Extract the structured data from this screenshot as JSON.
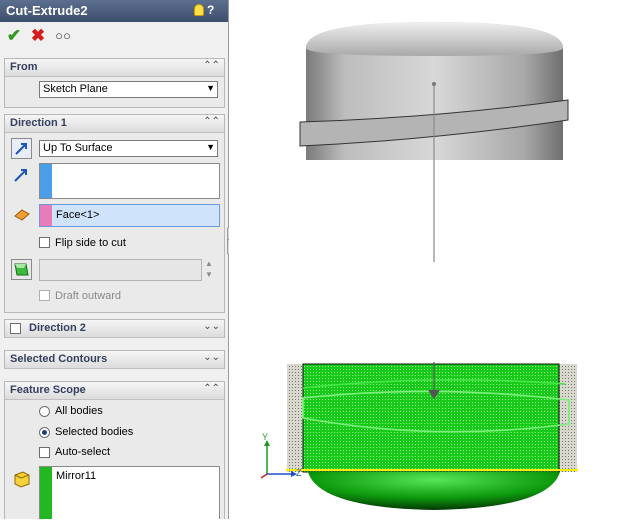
{
  "feature": {
    "title": "Cut-Extrude2",
    "help_glyph": "?",
    "tip_glyph": "!"
  },
  "toolbar": {
    "ok_icon": "check-icon",
    "cancel_icon": "x-icon",
    "preview_icon": "glasses-icon"
  },
  "from": {
    "header": "From",
    "value": "Sketch Plane"
  },
  "direction1": {
    "header": "Direction 1",
    "end_condition": "Up To Surface",
    "face_value": "Face<1>",
    "flip_label": "Flip side to cut",
    "draft_label": "Draft outward",
    "colors": {
      "direction_swatch": "#4a9ee8",
      "face_swatch": "#e87cb8"
    }
  },
  "direction2": {
    "header": "Direction 2"
  },
  "selected_contours": {
    "header": "Selected Contours"
  },
  "feature_scope": {
    "header": "Feature Scope",
    "options": [
      "All bodies",
      "Selected bodies"
    ],
    "selected_index": 1,
    "auto_select_label": "Auto-select",
    "bodies": [
      "Mirror11"
    ],
    "colors": {
      "body_swatch": "#22b822"
    }
  },
  "triad": {
    "y": "Y",
    "z": "Z"
  },
  "viewport_colors": {
    "body_top": "#b9b9b9",
    "cut_preview": "#16c516",
    "selection_outline": "#ffee00"
  }
}
